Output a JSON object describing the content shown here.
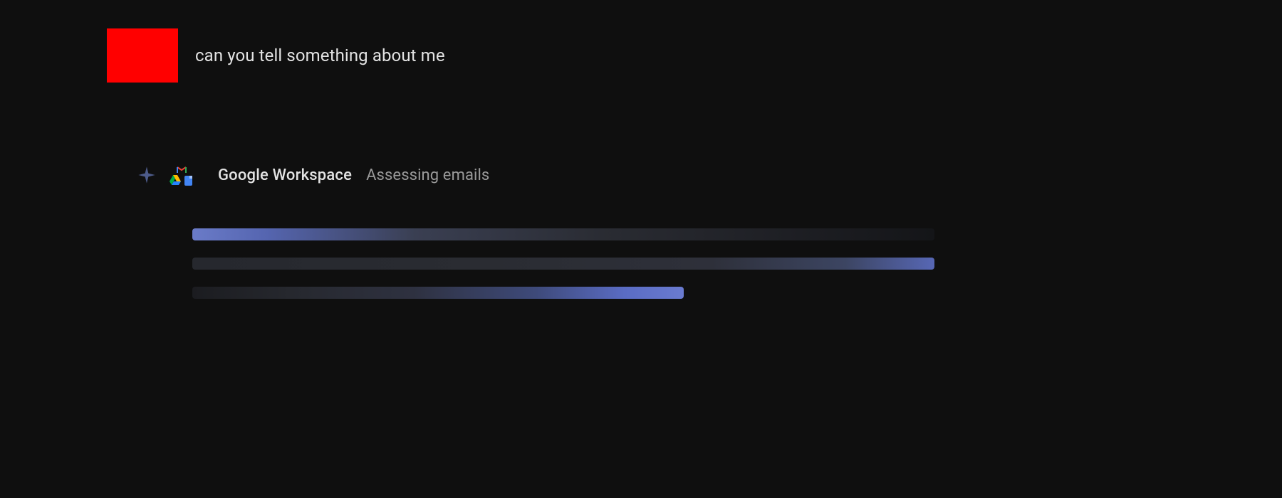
{
  "user": {
    "message": "can you tell something about me"
  },
  "assistant": {
    "tool_name": "Google Workspace",
    "status_text": "Assessing emails"
  },
  "icons": {
    "sparkle": "sparkle-icon",
    "gmail": "gmail-icon",
    "drive": "drive-icon",
    "docs": "docs-icon"
  }
}
